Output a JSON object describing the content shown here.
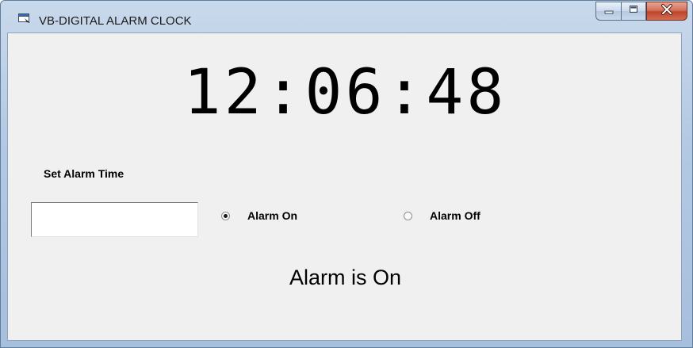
{
  "window": {
    "title": "VB-DIGITAL ALARM CLOCK",
    "icon": "form-window-icon",
    "buttons": {
      "minimize": "minimize-icon",
      "maximize": "maximize-icon",
      "close": "close-icon"
    },
    "colors": {
      "client_background": "#f0f0f0",
      "close_button": "#c9472d"
    }
  },
  "clock": {
    "time": "12:06:48"
  },
  "alarm": {
    "set_label": "Set Alarm Time",
    "input_value": "",
    "options": {
      "on_label": "Alarm On",
      "off_label": "Alarm Off",
      "selected": "on"
    },
    "status": "Alarm is On"
  }
}
